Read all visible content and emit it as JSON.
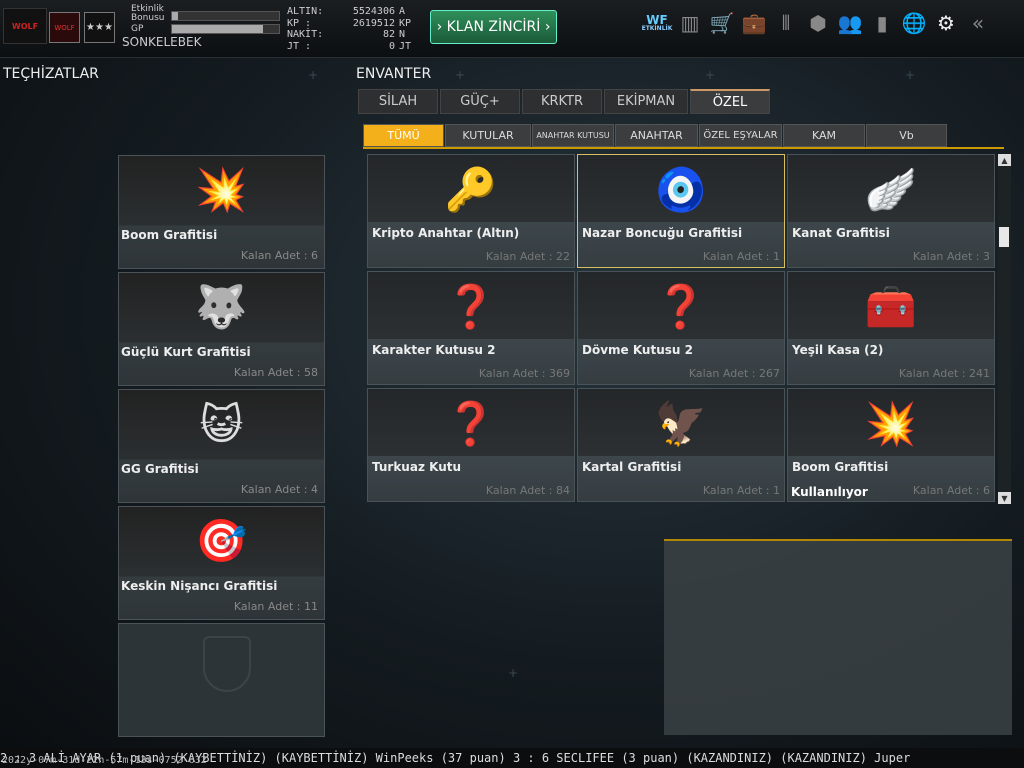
{
  "header": {
    "logo_text": "WOLF",
    "badge1_text": "WOLF",
    "badge2_text": "★★★",
    "bonus_label": "Etkinlik Bonusu",
    "gp_label": "GP",
    "bonus_progress": 0.06,
    "gp_progress": 0.85,
    "username": "SONKELEBEK",
    "currency": [
      {
        "label": "ALTIN:",
        "value": "5524306",
        "unit": "A"
      },
      {
        "label": "KP :",
        "value": "2619512",
        "unit": "KP"
      },
      {
        "label": "NAKİT:",
        "value": "82",
        "unit": "N"
      },
      {
        "label": "JT :",
        "value": "0",
        "unit": "JT"
      }
    ],
    "clan_button": "› KLAN ZİNCİRİ ›",
    "wf_label": "WF",
    "wf_sub": "ETKİNLİK"
  },
  "sections": {
    "equipment_title": "TEÇHİZATLAR",
    "inventory_title": "ENVANTER"
  },
  "equipment": [
    {
      "name": "Boom Grafitisi",
      "count": "Kalan Adet : 6",
      "icon": "💥"
    },
    {
      "name": "Güçlü Kurt Grafitisi",
      "count": "Kalan Adet : 58",
      "icon": "🐺"
    },
    {
      "name": "GG Grafitisi",
      "count": "Kalan Adet : 4",
      "icon": "😺"
    },
    {
      "name": "Keskin Nişancı Grafitisi",
      "count": "Kalan Adet : 11",
      "icon": "🎯"
    }
  ],
  "tabs": [
    "SİLAH",
    "GÜÇ+",
    "KRKTR",
    "EKİPMAN",
    "ÖZEL"
  ],
  "subtabs": [
    "TÜMÜ",
    "KUTULAR",
    "ANAHTAR KUTUSU",
    "ANAHTAR",
    "ÖZEL EŞYALAR",
    "KAM",
    "Vb"
  ],
  "inventory": [
    {
      "name": "Kripto Anahtar (Altın)",
      "count": "Kalan Adet : 22",
      "icon": "🔑"
    },
    {
      "name": "Nazar Boncuğu Grafitisi",
      "count": "Kalan Adet : 1",
      "icon": "🧿"
    },
    {
      "name": "Kanat Grafitisi",
      "count": "Kalan Adet : 3",
      "icon": "🪽"
    },
    {
      "name": "Karakter Kutusu 2",
      "count": "Kalan Adet : 369",
      "icon": "❓"
    },
    {
      "name": "Dövme Kutusu 2",
      "count": "Kalan Adet : 267",
      "icon": "❓"
    },
    {
      "name": "Yeşil Kasa (2)",
      "count": "Kalan Adet : 241",
      "icon": "🧰"
    },
    {
      "name": "Turkuaz Kutu",
      "count": "Kalan Adet : 84",
      "icon": "❓"
    },
    {
      "name": "Kartal Grafitisi",
      "count": "Kalan Adet : 1",
      "icon": "🦅"
    },
    {
      "name": "Boom Grafitisi",
      "count": "Kalan Adet : 6",
      "icon": "💥",
      "status": "Kullanılıyor"
    }
  ],
  "ticker": "2 : 3 ALİ AYAR (1 puan) (KAYBETTİNİZ)    (KAYBETTİNİZ) WinPeeks (37 puan) 3 : 6 SECLIFEE (3 puan) (KAZANDINIZ)      (KAZANDINIZ) Juper",
  "stamp": "2022y-07m-31d-22h-57m-13s-0752-632",
  "colors": {
    "accent": "#f3b01a",
    "clan": "#2f8f5a",
    "selected_border": "#d8c060"
  }
}
